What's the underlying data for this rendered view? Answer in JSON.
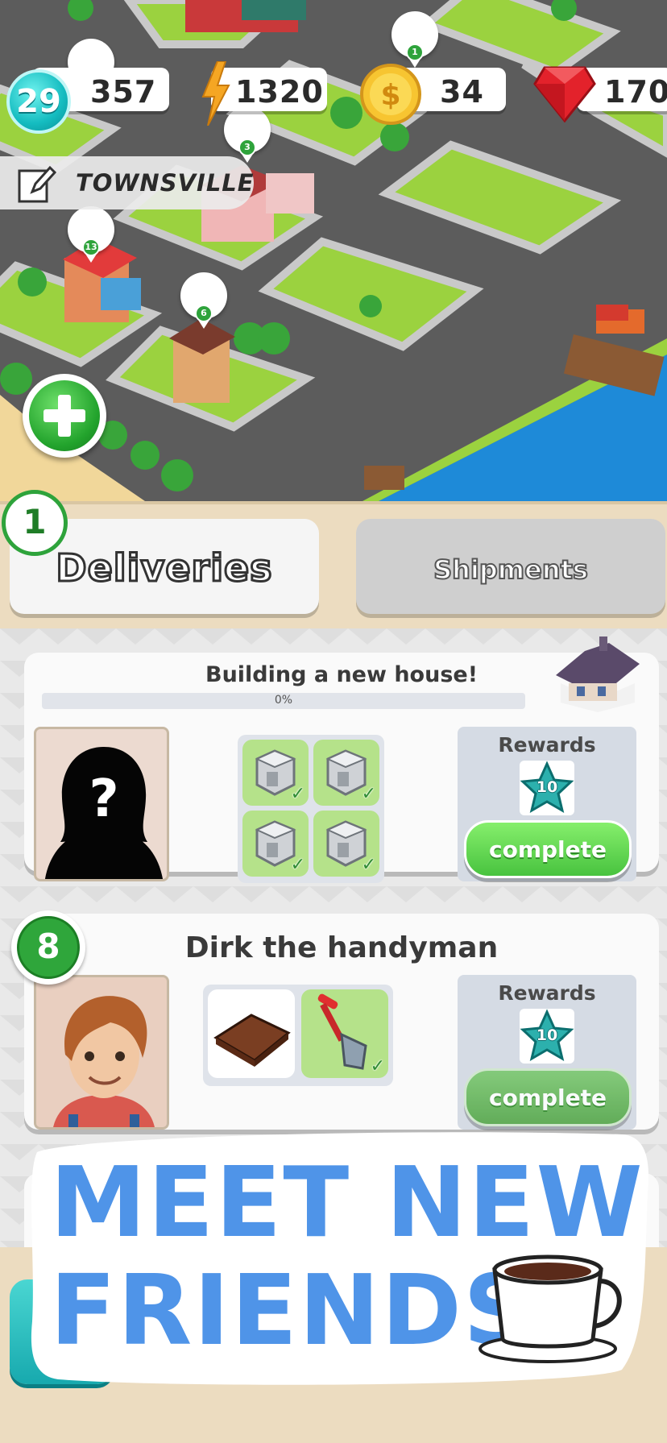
{
  "hud": {
    "level": "29",
    "population": "357",
    "energy": "1320",
    "coins": "34",
    "gems": "170"
  },
  "town": {
    "name": "TOWNSVILLE"
  },
  "map_pins": [
    "1",
    "3",
    "13",
    "6"
  ],
  "tabs": {
    "count": "1",
    "deliveries": "Deliveries",
    "shipments": "Shipments"
  },
  "cards": [
    {
      "title": "Building a new house!",
      "progress_text": "0%",
      "progress": 0,
      "rewards_label": "Rewards",
      "reward_value": "10",
      "button": "complete"
    },
    {
      "level": "8",
      "title": "Dirk the handyman",
      "rewards_label": "Rewards",
      "reward_value": "10",
      "button": "complete"
    }
  ],
  "promo": {
    "line1": "MEET NEW",
    "line2": "FRIENDS"
  },
  "colors": {
    "accent_green": "#48c33f",
    "promo_blue": "#4f94e8",
    "panel": "#ecdcc0"
  }
}
